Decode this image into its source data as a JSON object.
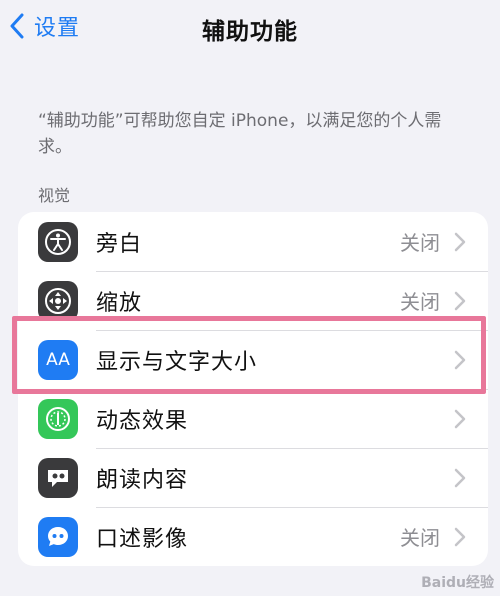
{
  "nav": {
    "back_label": "设置",
    "title": "辅助功能"
  },
  "description": "“辅助功能”可帮助您自定 iPhone，以满足您的个人需求。",
  "section_title": "视觉",
  "rows": [
    {
      "label": "旁白",
      "value": "关闭",
      "icon": "voiceover-icon",
      "icon_color": "#3a3a3c"
    },
    {
      "label": "缩放",
      "value": "关闭",
      "icon": "zoom-icon",
      "icon_color": "#3a3a3c"
    },
    {
      "label": "显示与文字大小",
      "value": "",
      "icon": "text-size-icon",
      "icon_color": "#1f7cf3",
      "highlighted": true
    },
    {
      "label": "动态效果",
      "value": "",
      "icon": "motion-icon",
      "icon_color": "#34c759"
    },
    {
      "label": "朗读内容",
      "value": "",
      "icon": "spoken-content-icon",
      "icon_color": "#3a3a3c"
    },
    {
      "label": "口述影像",
      "value": "关闭",
      "icon": "audio-description-icon",
      "icon_color": "#1f7cf3"
    }
  ],
  "icon_text": {
    "text_size": "AA"
  },
  "watermark": "Baidu经验",
  "colors": {
    "accent": "#1f7cf3",
    "highlight_border": "#e8779a",
    "background": "#f2f2f7"
  }
}
